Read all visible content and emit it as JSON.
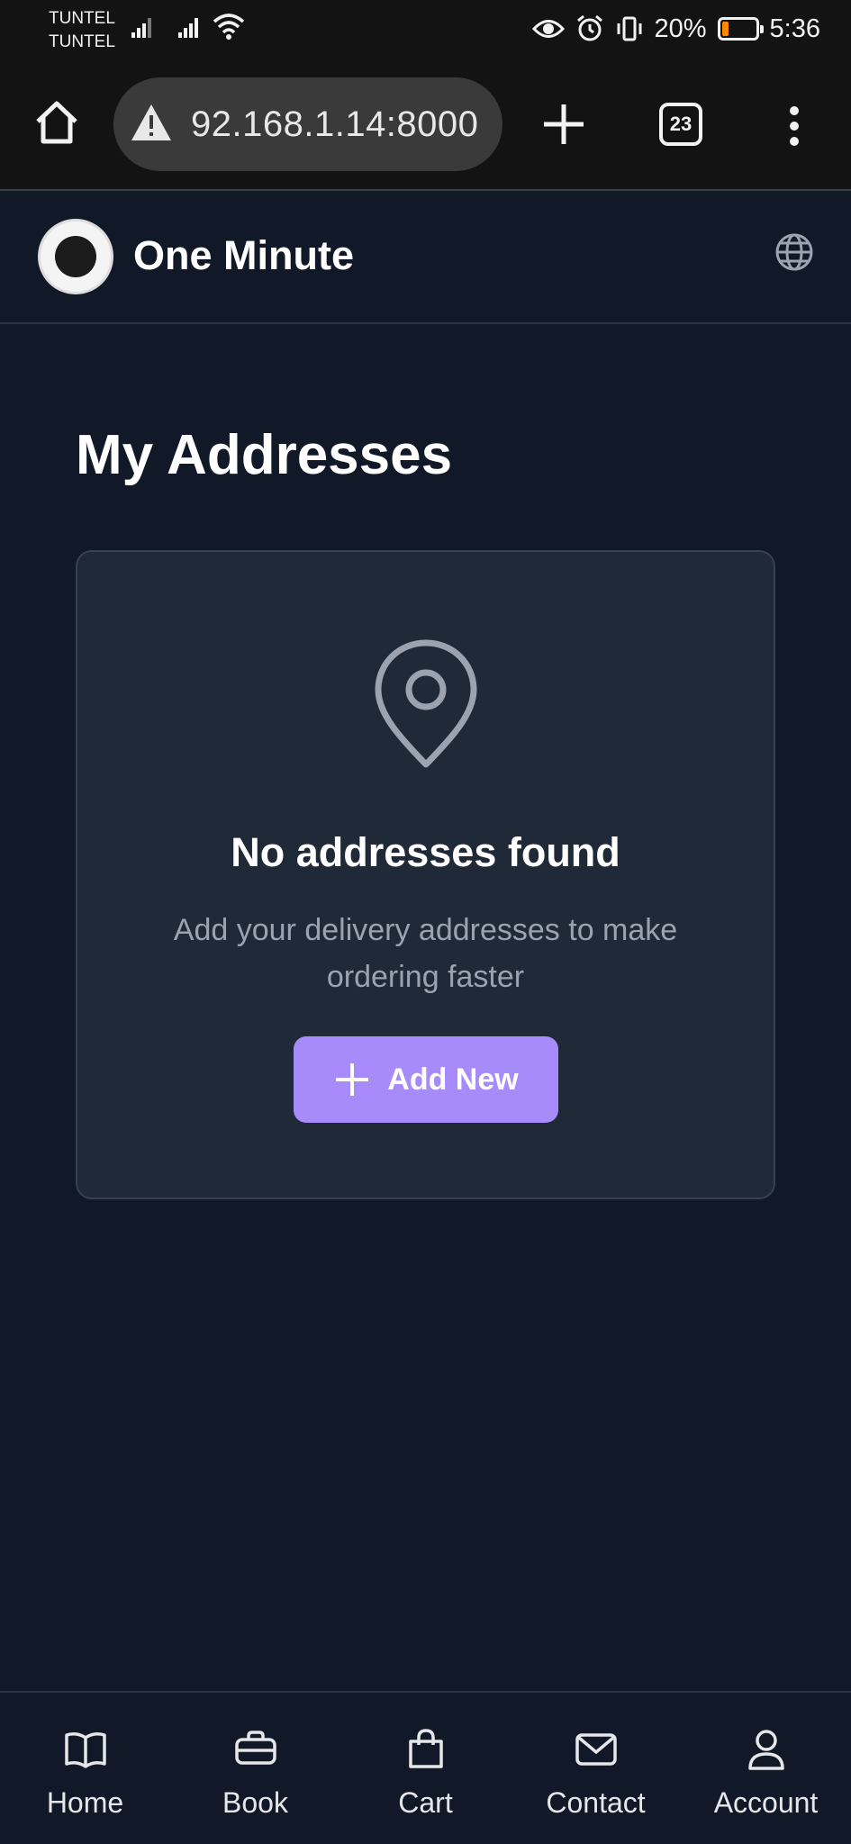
{
  "status_bar": {
    "carrier_1": "TUNTEL",
    "carrier_2": "TUNTEL",
    "battery": "20%",
    "battery_level": 0.2,
    "time": "5:36"
  },
  "browser": {
    "url": "92.168.1.14:8000",
    "tab_count": "23"
  },
  "header": {
    "brand": "One Minute"
  },
  "main": {
    "title": "My Addresses",
    "empty_title": "No addresses found",
    "empty_subtitle": "Add your delivery addresses to make ordering faster",
    "add_button": "Add New"
  },
  "nav": {
    "items": [
      {
        "label": "Home",
        "icon": "book-open-icon"
      },
      {
        "label": "Book",
        "icon": "briefcase-icon"
      },
      {
        "label": "Cart",
        "icon": "shopping-bag-icon"
      },
      {
        "label": "Contact",
        "icon": "mail-icon"
      },
      {
        "label": "Account",
        "icon": "user-icon"
      }
    ]
  },
  "colors": {
    "background": "#111827",
    "card": "#1f2937",
    "accent": "#a78bfa",
    "muted_text": "#9ca3af",
    "battery_low": "#ff8a00"
  }
}
